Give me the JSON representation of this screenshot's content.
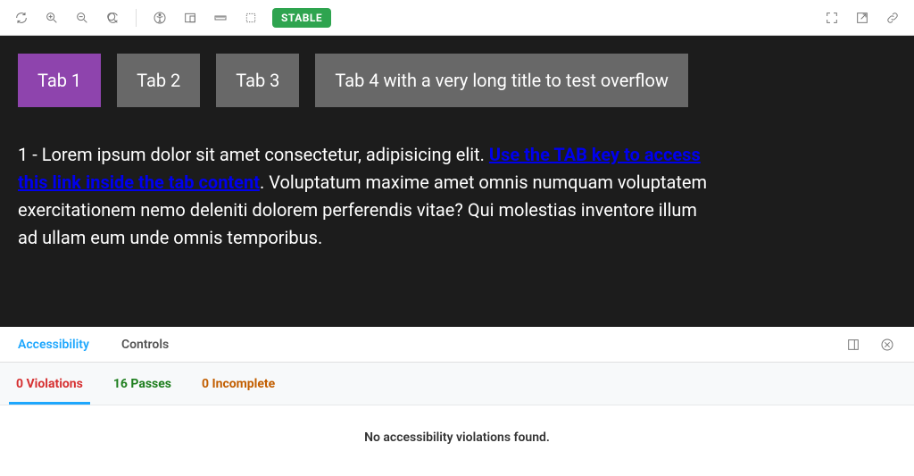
{
  "toolbar": {
    "badge": "STABLE"
  },
  "preview": {
    "tabs": [
      {
        "label": "Tab 1"
      },
      {
        "label": "Tab 2"
      },
      {
        "label": "Tab 3"
      },
      {
        "label": "Tab 4 with a very long title to test overflow"
      }
    ],
    "content": {
      "line1": "1 - Lorem ipsum dolor sit amet consectetur, adipisicing elit. ",
      "link": "Use the TAB key to access this link inside the tab content",
      "afterlink": ". Voluptatum maxime amet omnis numquam voluptatem exercitationem nemo deleniti dolorem perferendis vitae? Qui molestias inventore illum ad ullam eum unde omnis temporibus."
    }
  },
  "panel": {
    "tabs": {
      "accessibility": "Accessibility",
      "controls": "Controls"
    },
    "subtabs": {
      "violations": "0 Violations",
      "passes": "16 Passes",
      "incomplete": "0 Incomplete"
    },
    "empty": "No accessibility violations found."
  }
}
